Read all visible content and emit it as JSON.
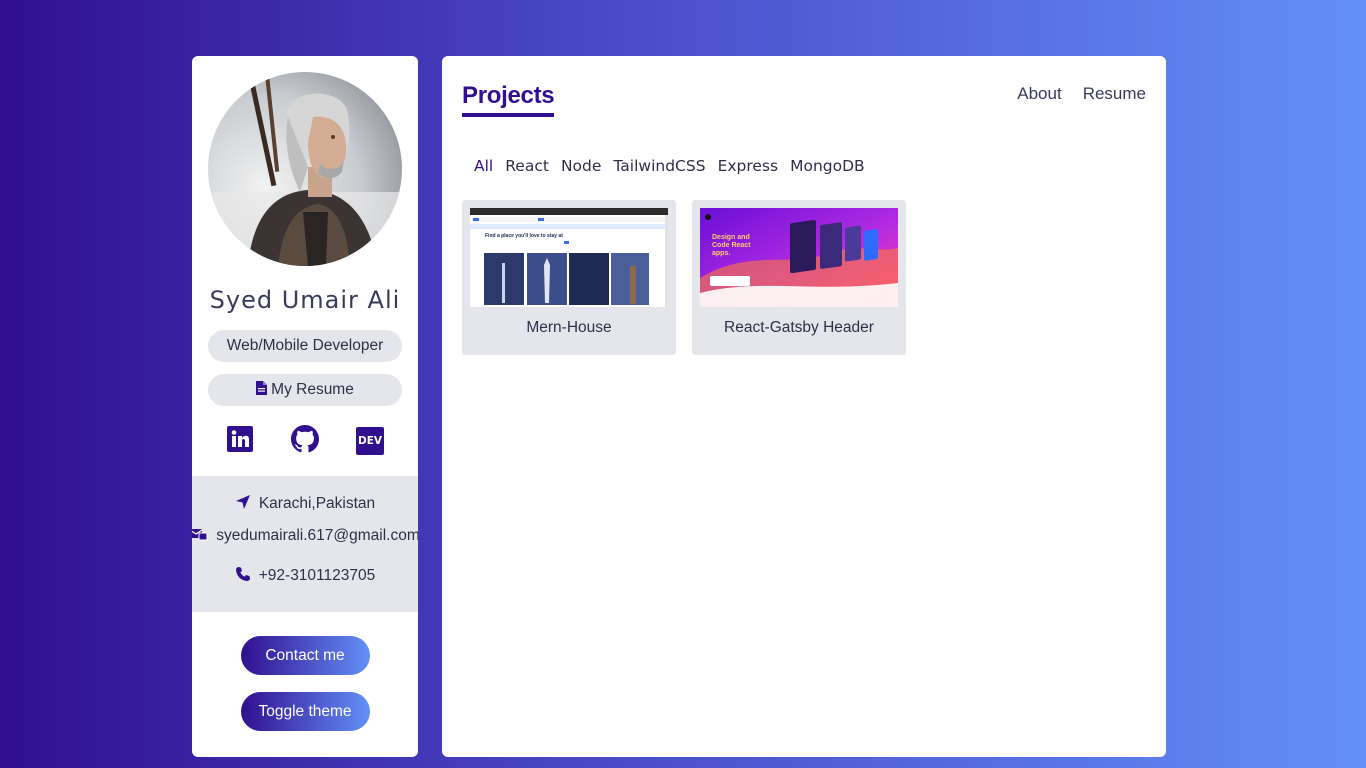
{
  "profile": {
    "name": "Syed Umair Ali",
    "role": "Web/Mobile Developer",
    "resume_label": "My Resume"
  },
  "socials": [
    {
      "icon": "linkedin-icon"
    },
    {
      "icon": "github-icon"
    },
    {
      "icon": "dev-icon",
      "label": "DEV"
    }
  ],
  "contact": {
    "location": "Karachi,Pakistan",
    "email": "syedumairali.617@gmail.com",
    "phone": "+92-3101123705"
  },
  "buttons": {
    "contact": "Contact me",
    "toggle": "Toggle theme"
  },
  "main": {
    "title": "Projects",
    "nav": [
      "About",
      "Resume"
    ],
    "filters": [
      "All",
      "React",
      "Node",
      "TailwindCSS",
      "Express",
      "MongoDB"
    ],
    "active_filter": "All",
    "projects": [
      {
        "title": "Mern-House",
        "thumb_text": "Find a place you'll love to stay at"
      },
      {
        "title": "React-Gatsby Header",
        "thumb_text": "Design and Code React apps."
      }
    ]
  },
  "colors": {
    "accent": "#310f8e",
    "gradient_end": "#6390f8",
    "pill_bg": "#e5e6eb"
  }
}
